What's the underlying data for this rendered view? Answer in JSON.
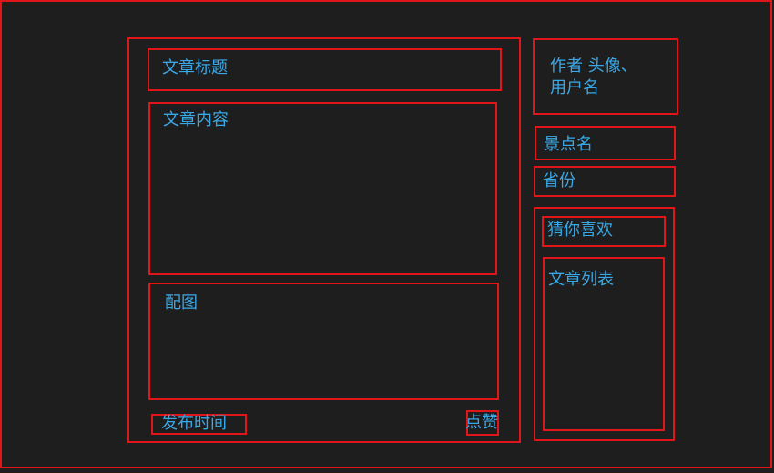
{
  "article": {
    "title": "文章标题",
    "content": "文章内容",
    "image": "配图",
    "publish_time": "发布时间",
    "like": "点赞"
  },
  "sidebar": {
    "author_line1": "作者 头像、",
    "author_line2": "用户名",
    "scenic_spot": "景点名",
    "province": "省份",
    "recommend_title": "猜你喜欢",
    "article_list": "文章列表"
  },
  "colors": {
    "background": "#1e1e1e",
    "border": "#e0161b",
    "text": "#3aa8e6"
  }
}
